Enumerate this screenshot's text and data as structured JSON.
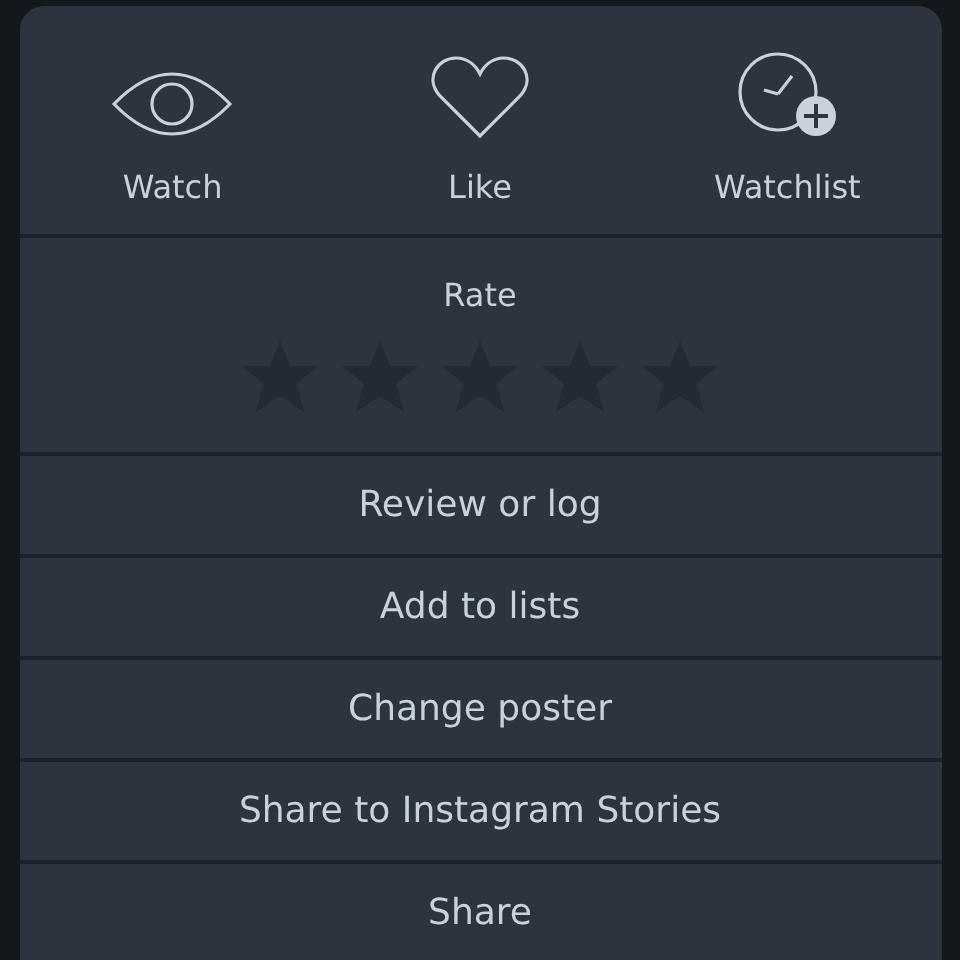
{
  "actions": [
    {
      "kind": "watch",
      "label": "Watch"
    },
    {
      "kind": "like",
      "label": "Like"
    },
    {
      "kind": "watchlist",
      "label": "Watchlist"
    }
  ],
  "rating": {
    "label": "Rate"
  },
  "menu_items": [
    "Review or log",
    "Add to lists",
    "Change poster",
    "Share to Instagram Stories",
    "Share"
  ]
}
